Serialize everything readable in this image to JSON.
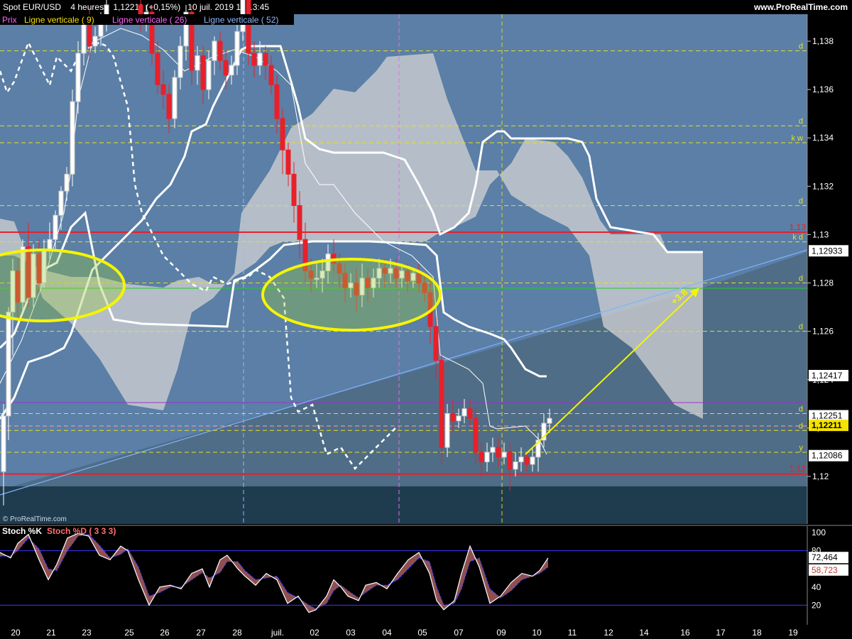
{
  "header": {
    "symbol": "Spot EUR/USD",
    "timeframe": "4 heures",
    "last": "1,12211 (+0,15%)",
    "datetime": "10 juil. 2019 10:13:45",
    "brand": "www.ProRealTime.com"
  },
  "legend": {
    "prix": "Prix",
    "v9": "Ligne verticale ( 9)",
    "v26": "Ligne verticale ( 26)",
    "v52": "Ligne verticale ( 52)"
  },
  "watermark": "© ProRealTime.com",
  "stoch": {
    "k_label": "Stoch %K",
    "d_label": "Stoch %D ( 3 3 3)",
    "k_value": "72,464",
    "d_value": "58,723",
    "ticks": [
      "100",
      "80",
      "60",
      "40",
      "20"
    ]
  },
  "colors": {
    "background": "#5b7fa6",
    "cloud": "#d3d3d3",
    "bull_candle": "#ffffff",
    "bear_candle": "#e8202a",
    "support_resistance": "#e8202a",
    "level_lines": "#e8e020",
    "stoch_k": "#ffffff",
    "stoch_d": "#3a3aff",
    "trend_line": "#7fb2ff"
  },
  "chart_data": {
    "type": "candlestick",
    "title": "Spot EUR/USD 4 heures",
    "y_ticks": [
      "1,138",
      "1,136",
      "1,134",
      "1,132",
      "1,13",
      "1,128",
      "1,126",
      "1,124",
      "1,122",
      "1,12"
    ],
    "ylim": [
      1.1195,
      1.1395
    ],
    "x_labels": [
      "20",
      "21",
      "23",
      "25",
      "26",
      "27",
      "28",
      "juil.",
      "02",
      "03",
      "04",
      "05",
      "07",
      "09",
      "10",
      "11",
      "12",
      "14",
      "16",
      "17",
      "18",
      "19"
    ],
    "price_badges": [
      {
        "text": "1,12933",
        "value": 1.12933
      },
      {
        "text": "1,12417",
        "value": 1.12417
      },
      {
        "text": "1,12251",
        "value": 1.12251
      },
      {
        "text": "1,12211",
        "value": 1.12211
      },
      {
        "text": "1,12086",
        "value": 1.12086
      }
    ],
    "red_levels": [
      {
        "label": "1,13",
        "value": 1.1301
      },
      {
        "label": "1,12",
        "value": 1.1201
      }
    ],
    "level_marks": [
      {
        "label": "d",
        "value": 1.1376
      },
      {
        "label": "d",
        "value": 1.1345
      },
      {
        "label": "k w",
        "value": 1.1338
      },
      {
        "label": "d",
        "value": 1.1312
      },
      {
        "label": "k d",
        "value": 1.1297
      },
      {
        "label": "d",
        "value": 1.128
      },
      {
        "label": "d",
        "value": 1.126
      },
      {
        "label": "d",
        "value": 1.1226
      },
      {
        "label": "d",
        "value": 1.1219
      },
      {
        "label": "y",
        "value": 1.121
      }
    ],
    "annotation": "+3.8"
  }
}
